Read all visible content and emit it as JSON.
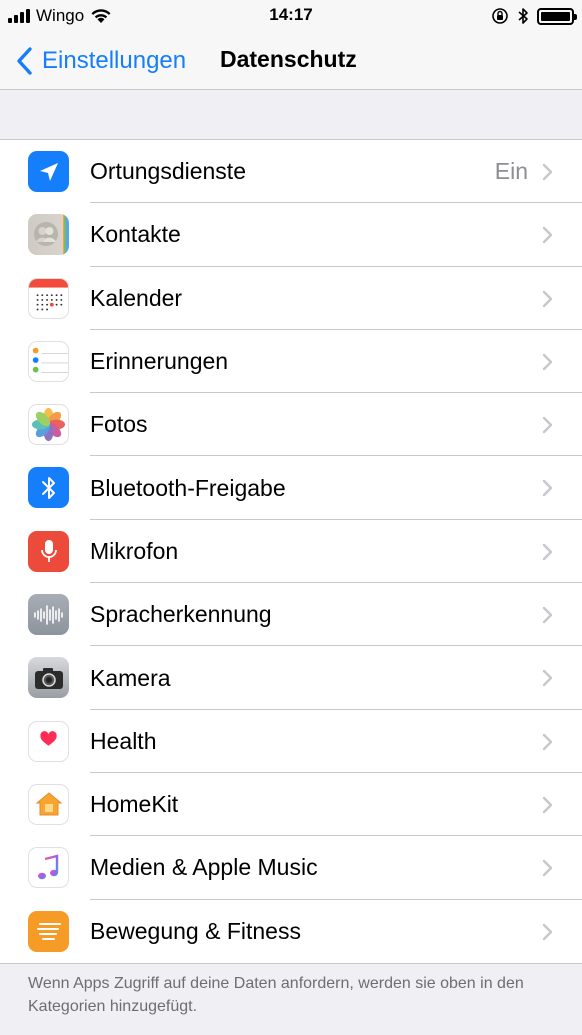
{
  "status_bar": {
    "carrier": "Wingo",
    "time": "14:17"
  },
  "nav": {
    "back_label": "Einstellungen",
    "title": "Datenschutz"
  },
  "rows": [
    {
      "label": "Ortungsdienste",
      "value": "Ein",
      "icon": "location-arrow-icon"
    },
    {
      "label": "Kontakte",
      "value": "",
      "icon": "contacts-icon"
    },
    {
      "label": "Kalender",
      "value": "",
      "icon": "calendar-icon"
    },
    {
      "label": "Erinnerungen",
      "value": "",
      "icon": "reminders-icon"
    },
    {
      "label": "Fotos",
      "value": "",
      "icon": "photos-icon"
    },
    {
      "label": "Bluetooth-Freigabe",
      "value": "",
      "icon": "bluetooth-icon"
    },
    {
      "label": "Mikrofon",
      "value": "",
      "icon": "microphone-icon"
    },
    {
      "label": "Spracherkennung",
      "value": "",
      "icon": "waveform-icon"
    },
    {
      "label": "Kamera",
      "value": "",
      "icon": "camera-icon"
    },
    {
      "label": "Health",
      "value": "",
      "icon": "heart-icon"
    },
    {
      "label": "HomeKit",
      "value": "",
      "icon": "house-icon"
    },
    {
      "label": "Medien & Apple Music",
      "value": "",
      "icon": "music-note-icon"
    },
    {
      "label": "Bewegung & Fitness",
      "value": "",
      "icon": "motion-icon"
    }
  ],
  "footer": {
    "text": "Wenn Apps Zugriff auf deine Daten anfordern, werden sie oben in den Kategorien hinzugefügt."
  },
  "colors": {
    "accent": "#157efb",
    "background": "#efeff4",
    "separator": "#c8c7cc"
  }
}
